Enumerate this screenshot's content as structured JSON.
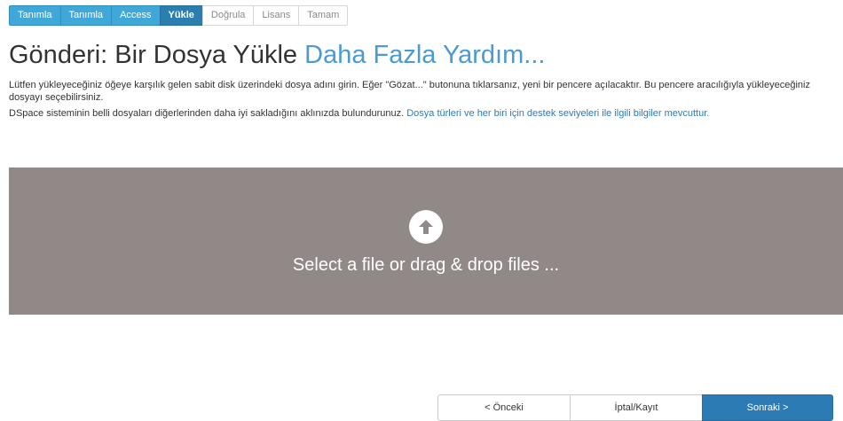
{
  "steps": [
    {
      "label": "Tanımla",
      "state": "done"
    },
    {
      "label": "Tanımla",
      "state": "done"
    },
    {
      "label": "Access",
      "state": "done"
    },
    {
      "label": "Yükle",
      "state": "current"
    },
    {
      "label": "Doğrula",
      "state": "todo"
    },
    {
      "label": "Lisans",
      "state": "todo"
    },
    {
      "label": "Tamam",
      "state": "todo"
    }
  ],
  "heading": {
    "title": "Gönderi: Bir Dosya Yükle",
    "help_link": "Daha Fazla Yardım..."
  },
  "instructions": {
    "paragraph1": "Lütfen yükleyeceğiniz öğeye karşılık gelen sabit disk üzerindeki dosya adını girin. Eğer \"Gözat...\" butonuna tıklarsanız, yeni bir pencere açılacaktır. Bu pencere aracılığıyla yükleyeceğiniz dosyayı seçebilirsiniz.",
    "paragraph2_text": "DSpace sisteminin belli dosyaları diğerlerinden daha iyi sakladığını aklınızda bulundurunuz.",
    "paragraph2_link": "Dosya türleri ve her biri için destek seviyeleri ile ilgili bilgiler mevcuttur."
  },
  "dropzone": {
    "icon": "upload-arrow-circle-icon",
    "text": "Select a file or drag & drop files ..."
  },
  "buttons": {
    "previous": "< Önceki",
    "cancel_save": "İptal/Kayıt",
    "next": "Sonraki >"
  },
  "colors": {
    "step_done": "#3fa8d9",
    "step_current": "#2b7fb0",
    "link": "#4a9bd1",
    "dropzone_bg": "#918987",
    "primary_button": "#2c7bb4"
  }
}
